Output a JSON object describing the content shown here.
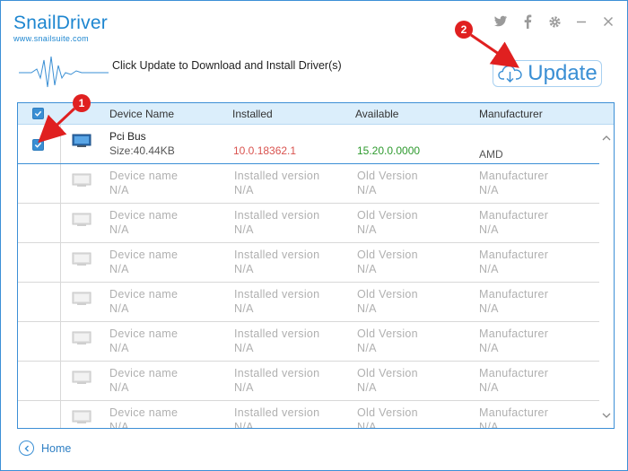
{
  "app": {
    "logo": "SnailDriver",
    "site": "www.snailsuite.com"
  },
  "window_controls": [
    "twitter-icon",
    "facebook-icon",
    "gear-icon",
    "minimize-icon",
    "close-icon"
  ],
  "message": "Click Update to Download and Install Driver(s)",
  "update_button": "Update",
  "annotations": {
    "badge1": "1",
    "badge2": "2"
  },
  "table": {
    "headers": {
      "device": "Device Name",
      "installed": "Installed",
      "available": "Available",
      "manufacturer": "Manufacturer"
    },
    "selected_row": {
      "name": "Pci Bus",
      "size": "Size:40.44KB",
      "installed": "10.0.18362.1",
      "available": "15.20.0.0000",
      "manufacturer": "AMD",
      "checked": true
    },
    "placeholder_row": {
      "name": "Device name",
      "installed": "Installed version",
      "available": "Old Version",
      "manufacturer": "Manufacturer",
      "na": "N/A"
    },
    "placeholder_count": 7
  },
  "footer": {
    "home": "Home"
  },
  "colors": {
    "accent": "#3a8fd4",
    "installed_red": "#d9534f",
    "available_green": "#2e9a2e",
    "annotation_red": "#e02020"
  }
}
